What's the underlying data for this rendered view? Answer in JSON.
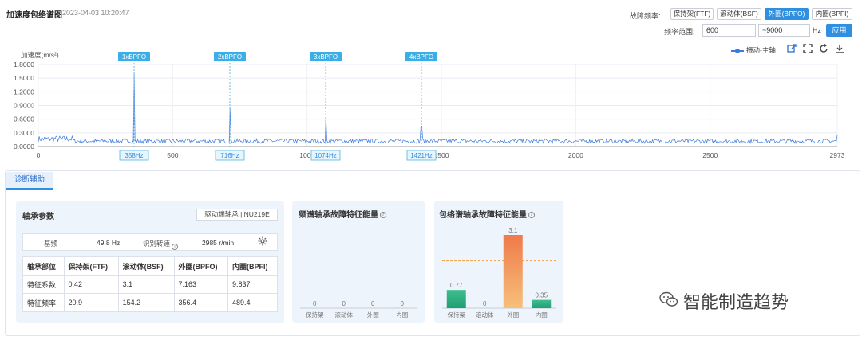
{
  "header": {
    "title": "加速度包络谱图",
    "timestamp": "2023-04-03 10:20:47",
    "fault_freq_label": "故障频率:",
    "fault_chips": [
      {
        "label": "保持架(FTF)",
        "active": false
      },
      {
        "label": "滚动体(BSF)",
        "active": false
      },
      {
        "label": "外圈(BPFO)",
        "active": true
      },
      {
        "label": "内圈(BPFI)",
        "active": false
      }
    ],
    "range_label": "频率范围:",
    "range_from": "600",
    "range_to": "~9000",
    "range_unit": "Hz",
    "apply_label": "应用"
  },
  "toolbar": {
    "legend_label": "振动-主轴",
    "icons": [
      "export-icon",
      "fullscreen-icon",
      "refresh-icon",
      "download-icon"
    ]
  },
  "chart_data": {
    "type": "line",
    "ylabel": "加速度(m/s²)",
    "ylim": [
      0,
      1.8
    ],
    "y_ticks": [
      "1.8000",
      "1.5000",
      "1.2000",
      "0.9000",
      "0.6000",
      "0.3000",
      "0.0000"
    ],
    "y_tick_values": [
      1.8,
      1.5,
      1.2,
      0.9,
      0.6,
      0.3,
      0
    ],
    "xlim": [
      0,
      2973
    ],
    "x_ticks": [
      "0",
      "500",
      "1000",
      "1500",
      "2000",
      "2500",
      "2973"
    ],
    "x_tick_values": [
      0,
      500,
      1000,
      1500,
      2000,
      2500,
      2973
    ],
    "baseline_level": 0.12,
    "peaks": [
      {
        "x": 356.4,
        "y": 1.6,
        "label": "1xBPFO",
        "freq_label": "358Hz"
      },
      {
        "x": 712.8,
        "y": 0.85,
        "label": "2xBPFO",
        "freq_label": "716Hz"
      },
      {
        "x": 1069.2,
        "y": 0.65,
        "label": "3xBPFO",
        "freq_label": "1074Hz"
      },
      {
        "x": 1425.6,
        "y": 0.45,
        "label": "4xBPFO",
        "freq_label": "1421Hz"
      }
    ],
    "color": "#3d7be0"
  },
  "diagnosis": {
    "tab_label": "诊断辅助",
    "bearing_panel": {
      "title": "轴承参数",
      "bearing_badge": "驱动端轴承 | NU219E",
      "base_freq_label": "基频",
      "base_freq_value": "49.8 Hz",
      "speed_label": "识别转速",
      "speed_value": "2985 r/min",
      "table": [
        [
          "轴承部位",
          "保持架(FTF)",
          "滚动体(BSF)",
          "外圈(BPFO)",
          "内圈(BPFI)"
        ],
        [
          "特征系数",
          "0.42",
          "3.1",
          "7.163",
          "9.837"
        ],
        [
          "特征频率",
          "20.9",
          "154.2",
          "356.4",
          "489.4"
        ]
      ]
    },
    "spectrum_panel": {
      "title": "频谱轴承故障特征能量",
      "categories": [
        "保持架",
        "滚动体",
        "外圈",
        "内圈"
      ],
      "values": [
        0,
        0,
        0,
        0
      ],
      "value_labels": [
        "0",
        "0",
        "0",
        "0"
      ]
    },
    "envelope_panel": {
      "title": "包络谱轴承故障特征能量",
      "categories": [
        "保持架",
        "滚动体",
        "外圈",
        "内圈"
      ],
      "values": [
        0.77,
        0,
        3.1,
        0.35
      ],
      "value_labels": [
        "0.77",
        "0",
        "3.1",
        "0.35"
      ],
      "threshold": 2.0,
      "ymax": 3.1
    }
  },
  "watermark": "智能制造趋势"
}
